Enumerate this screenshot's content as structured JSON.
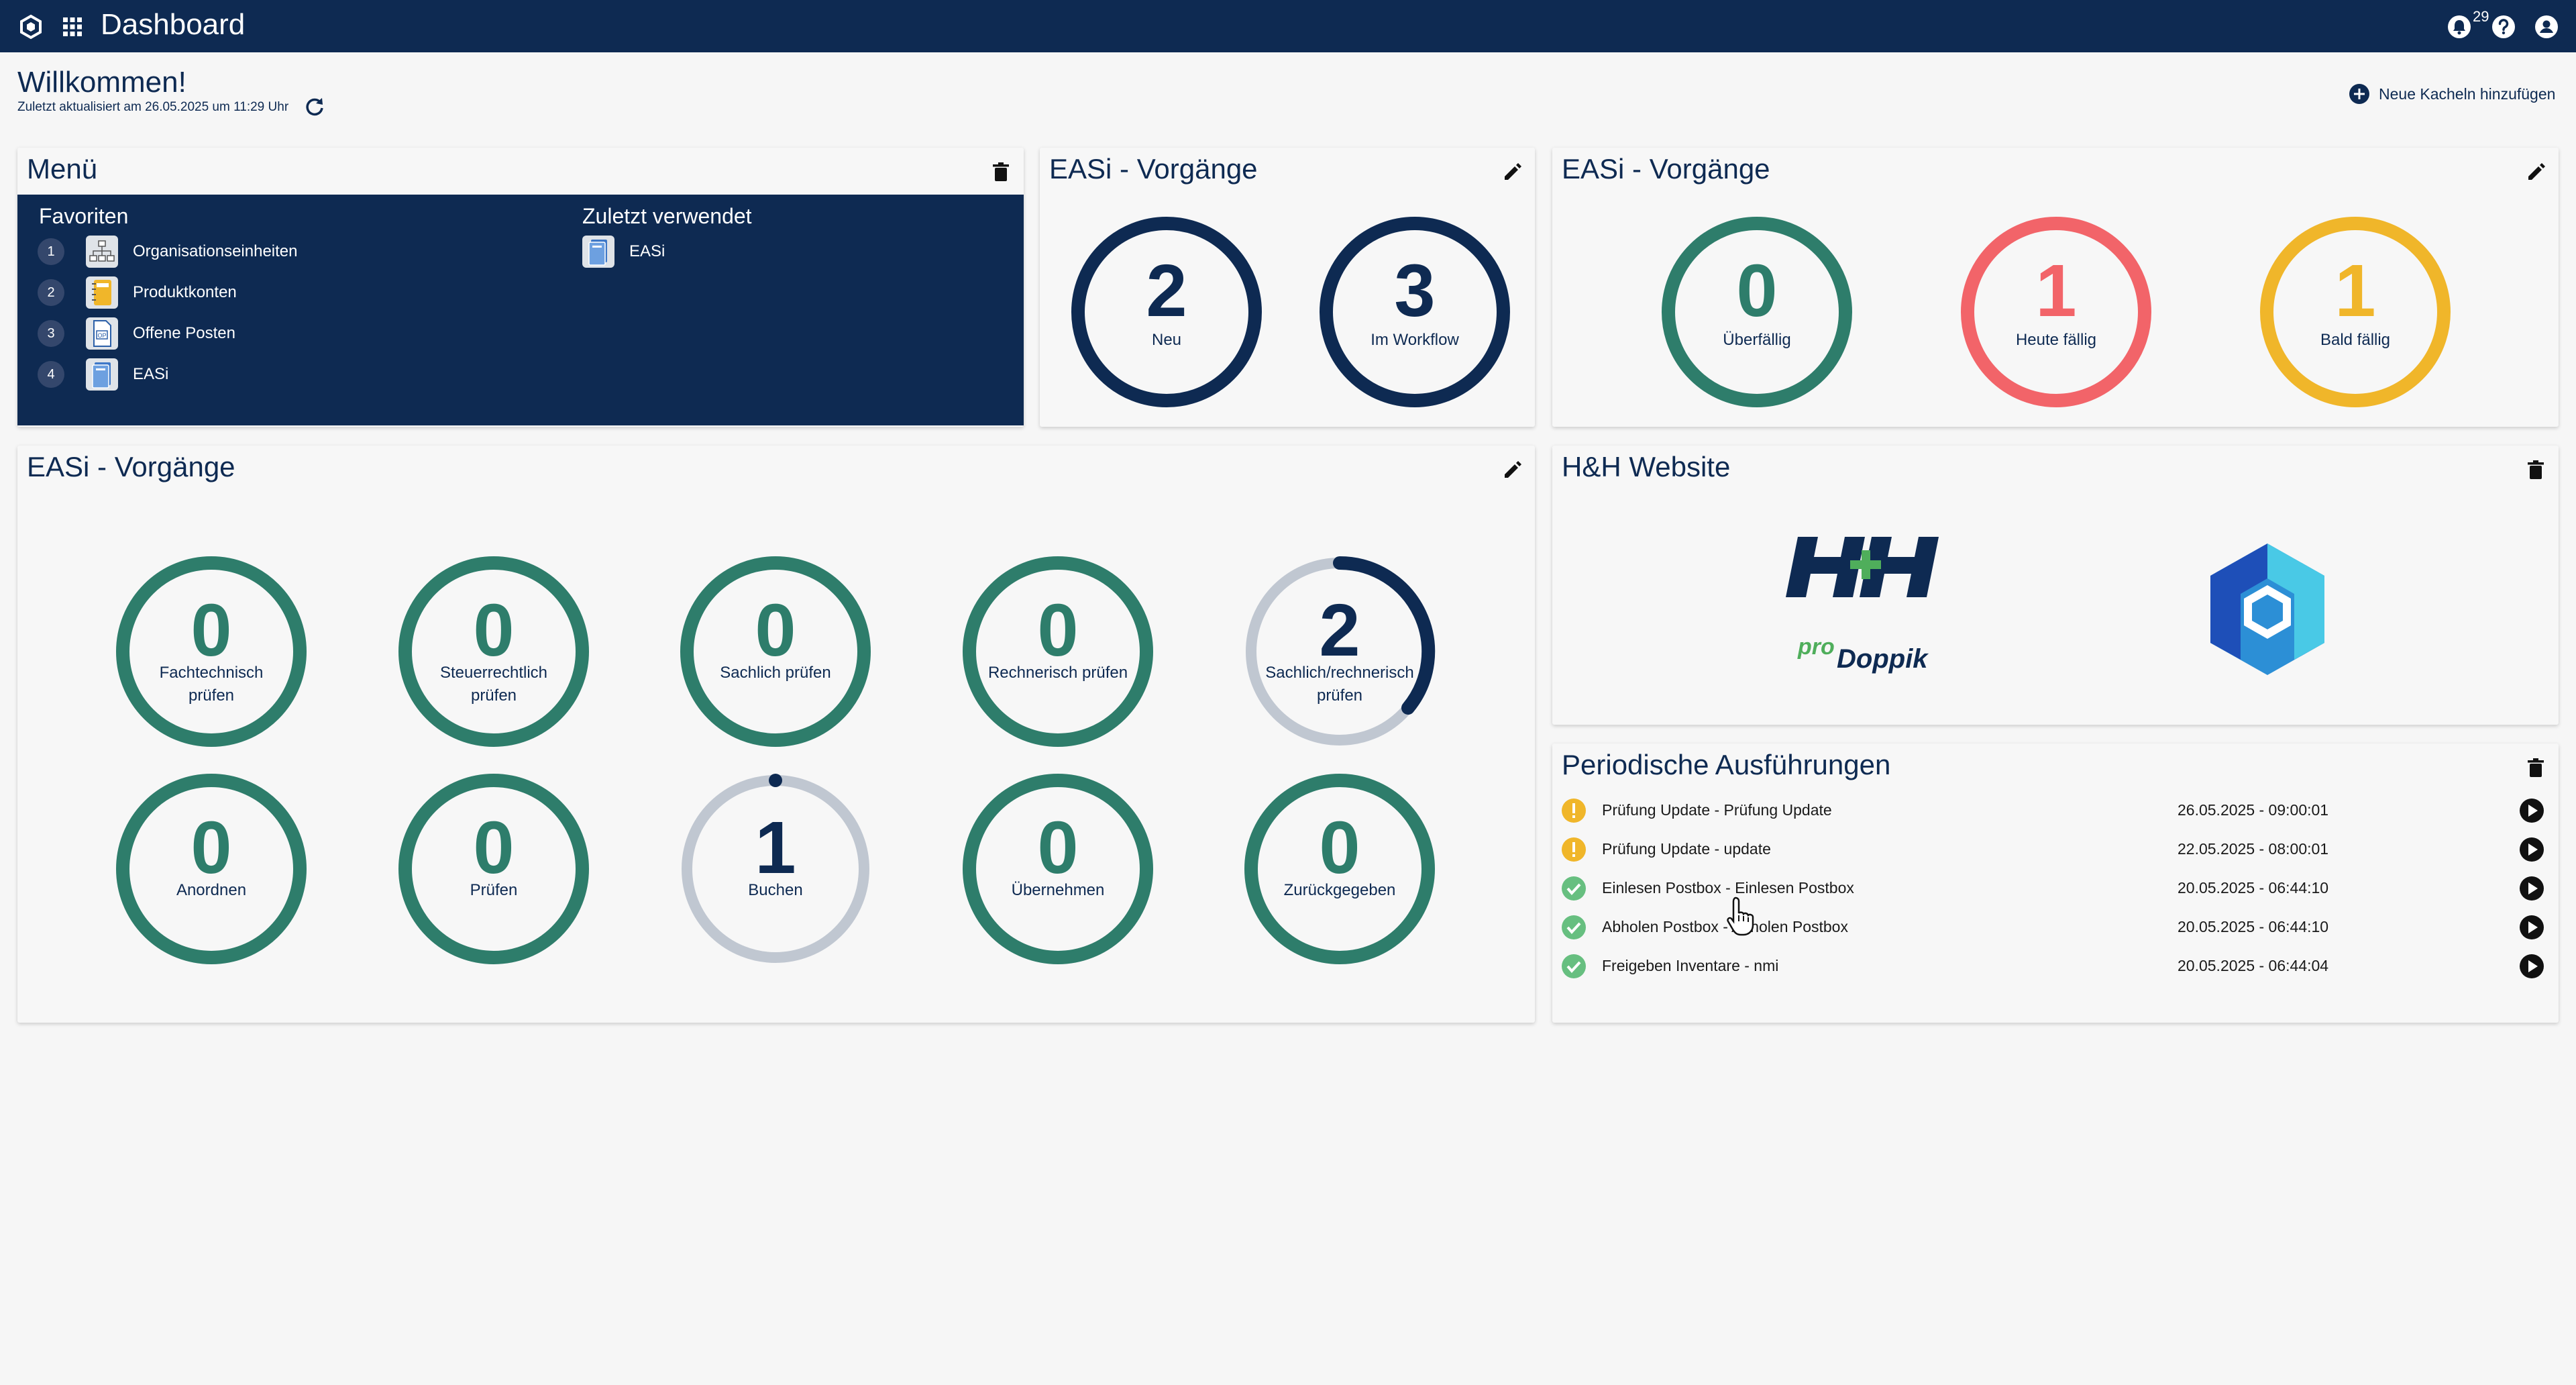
{
  "header": {
    "title": "Dashboard",
    "notification_count": "29",
    "bg_color": "#0e2a52",
    "icons": [
      "app-logo-icon",
      "apps-grid-icon",
      "bell-icon",
      "help-icon",
      "account-icon"
    ]
  },
  "welcome": {
    "title": "Willkommen!",
    "last_updated": "Zuletzt aktualisiert am 26.05.2025 um 11:29 Uhr",
    "add_tiles": "Neue Kacheln hinzufügen"
  },
  "menu_card": {
    "title": "Menü",
    "favorites_heading": "Favoriten",
    "recent_heading": "Zuletzt verwendet",
    "favorites": [
      {
        "num": "1",
        "label": "Organisationseinheiten",
        "icon": "org-chart-icon"
      },
      {
        "num": "2",
        "label": "Produktkonten",
        "icon": "notebook-icon"
      },
      {
        "num": "3",
        "label": "Offene Posten",
        "icon": "document-op-icon"
      },
      {
        "num": "4",
        "label": "EASi",
        "icon": "easi-icon"
      }
    ],
    "recent": [
      {
        "label": "EASi",
        "icon": "easi-icon"
      }
    ]
  },
  "easi_small_1": {
    "title": "EASi - Vorgänge",
    "gauges": [
      {
        "value": "2",
        "label": "Neu"
      },
      {
        "value": "3",
        "label": "Im Workflow"
      }
    ]
  },
  "easi_small_2": {
    "title": "EASi - Vorgänge",
    "gauges": [
      {
        "value": "0",
        "label": "Überfällig"
      },
      {
        "value": "1",
        "label": "Heute fällig"
      },
      {
        "value": "1",
        "label": "Bald fällig"
      }
    ]
  },
  "easi_large": {
    "title": "EASi - Vorgänge",
    "gauges": [
      {
        "value": "0",
        "label_lines": [
          "Fachtechnisch",
          "prüfen"
        ]
      },
      {
        "value": "0",
        "label_lines": [
          "Steuerrechtlich",
          "prüfen"
        ]
      },
      {
        "value": "0",
        "label_lines": [
          "Sachlich prüfen"
        ]
      },
      {
        "value": "0",
        "label_lines": [
          "Rechnerisch prüfen"
        ]
      },
      {
        "value": "2",
        "label_lines": [
          "Sachlich/rechnerisch",
          "prüfen"
        ]
      },
      {
        "value": "0",
        "label_lines": [
          "Anordnen"
        ]
      },
      {
        "value": "0",
        "label_lines": [
          "Prüfen"
        ]
      },
      {
        "value": "1",
        "label_lines": [
          "Buchen"
        ]
      },
      {
        "value": "0",
        "label_lines": [
          "Übernehmen"
        ]
      },
      {
        "value": "0",
        "label_lines": [
          "Zurückgegeben"
        ]
      }
    ]
  },
  "website_card": {
    "title": "H&H Website",
    "logo_text_top": "H+H",
    "logo_text_pro": "pro",
    "logo_text_doppik": "Doppik"
  },
  "periodic_card": {
    "title": "Periodische Ausführungen",
    "rows": [
      {
        "status": "warning",
        "name": "Prüfung Update - Prüfung Update",
        "date": "26.05.2025 - 09:00:01"
      },
      {
        "status": "warning",
        "name": "Prüfung Update - update",
        "date": "22.05.2025 - 08:00:01"
      },
      {
        "status": "success",
        "name": "Einlesen Postbox - Einlesen Postbox",
        "date": "20.05.2025 - 06:44:10"
      },
      {
        "status": "success",
        "name": "Abholen Postbox - Abholen Postbox",
        "date": "20.05.2025 - 06:44:10"
      },
      {
        "status": "success",
        "name": "Freigeben Inventare - nmi",
        "date": "20.05.2025 - 06:44:04"
      }
    ]
  },
  "colors": {
    "navy": "#0e2a52",
    "teal": "#2e7d6b",
    "red": "#f26469",
    "amber": "#f0b62a",
    "grey_ring": "#c0c7d1",
    "success": "#67bf80",
    "warning": "#f0b62a"
  }
}
